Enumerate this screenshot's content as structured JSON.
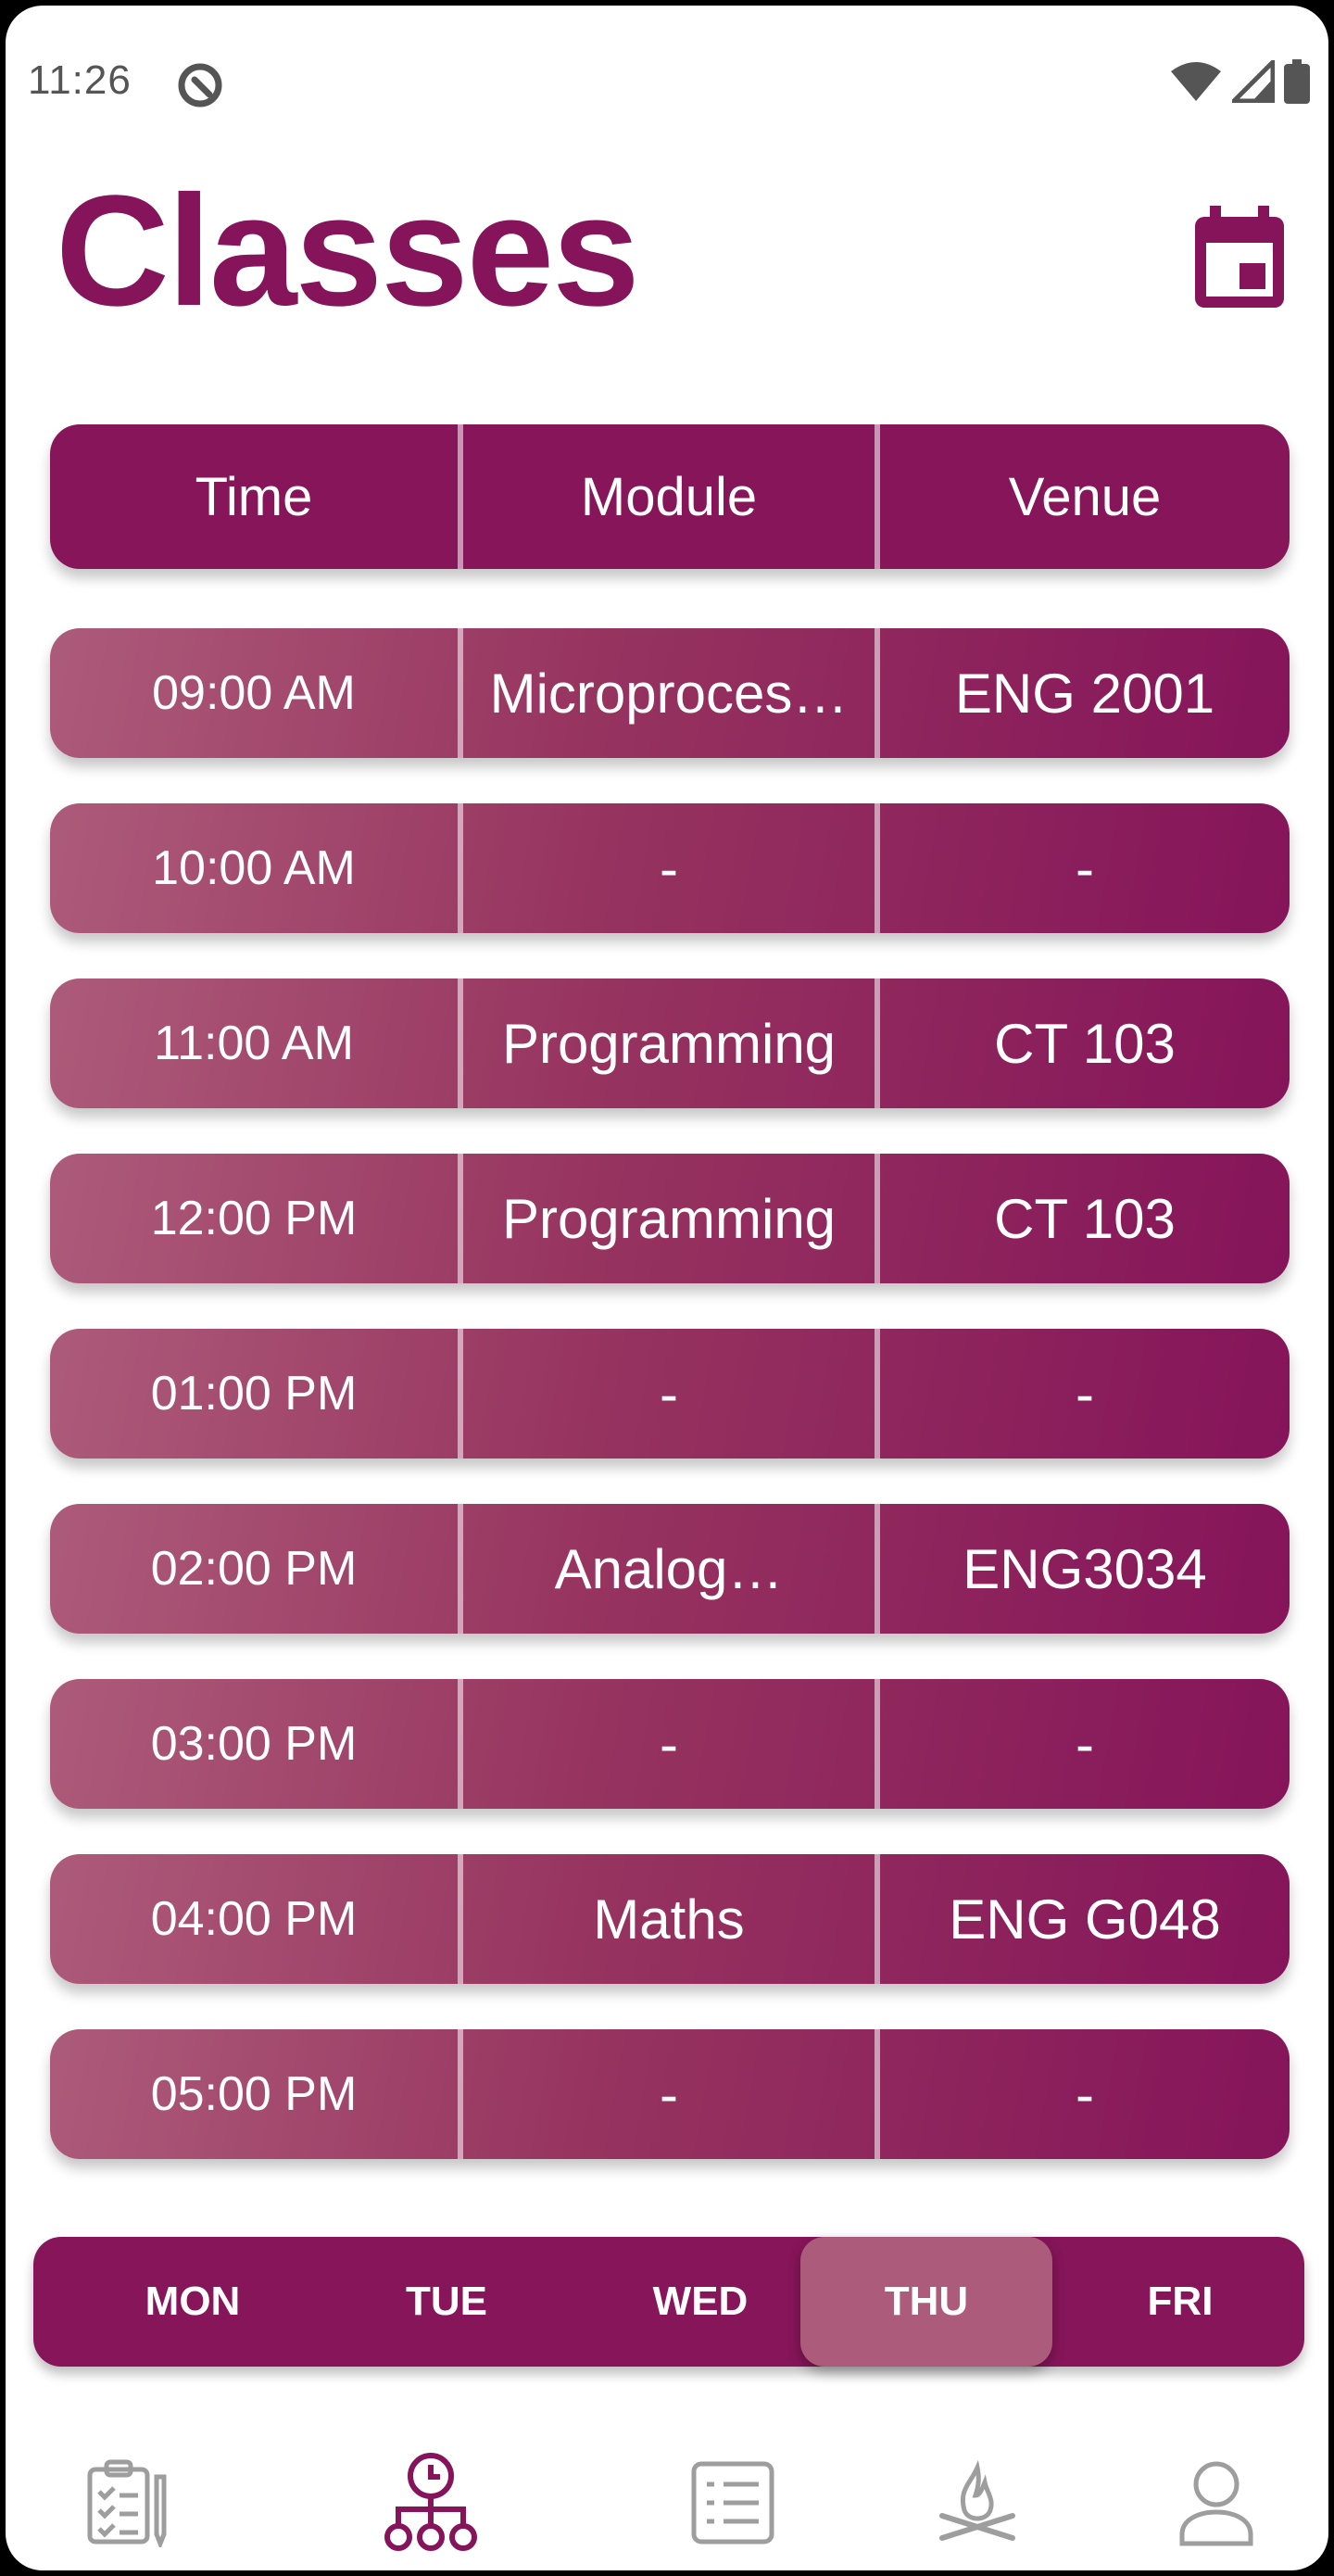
{
  "status_bar": {
    "time": "11:26"
  },
  "header": {
    "title": "Classes"
  },
  "table": {
    "columns": [
      "Time",
      "Module",
      "Venue"
    ],
    "rows": [
      {
        "time": "09:00 AM",
        "module": "Microproces…",
        "venue": "ENG 2001"
      },
      {
        "time": "10:00 AM",
        "module": "-",
        "venue": "-"
      },
      {
        "time": "11:00 AM",
        "module": "Programming",
        "venue": "CT 103"
      },
      {
        "time": "12:00 PM",
        "module": "Programming",
        "venue": "CT 103"
      },
      {
        "time": "01:00 PM",
        "module": "-",
        "venue": "-"
      },
      {
        "time": "02:00 PM",
        "module": "Analog…",
        "venue": "ENG3034"
      },
      {
        "time": "03:00 PM",
        "module": "-",
        "venue": "-"
      },
      {
        "time": "04:00 PM",
        "module": "Maths",
        "venue": "ENG G048"
      },
      {
        "time": "05:00 PM",
        "module": "-",
        "venue": "-"
      }
    ]
  },
  "day_tabs": {
    "items": [
      "MON",
      "TUE",
      "WED",
      "THU",
      "FRI"
    ],
    "selected": "THU"
  },
  "bottom_nav": {
    "items": [
      "clipboard-checklist-icon",
      "schedule-hierarchy-icon",
      "list-icon",
      "campfire-icon",
      "person-icon"
    ],
    "active": "schedule-hierarchy-icon"
  },
  "colors": {
    "primary": "#85145a",
    "row_light": "#ad5b7a",
    "nav_inactive": "#9e9e9e",
    "status_text": "#555555"
  }
}
